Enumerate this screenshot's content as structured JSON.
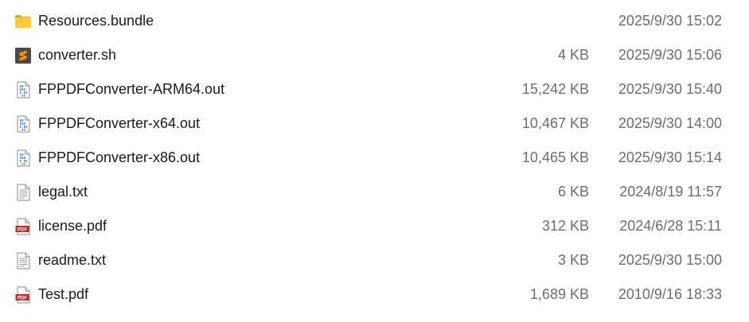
{
  "files": [
    {
      "name": "Resources.bundle",
      "size": "",
      "date": "2025/9/30 15:02",
      "icon": "folder-icon"
    },
    {
      "name": "converter.sh",
      "size": "4 KB",
      "date": "2025/9/30 15:06",
      "icon": "sublime-text-icon"
    },
    {
      "name": "FPPDFConverter-ARM64.out",
      "size": "15,242 KB",
      "date": "2025/9/30 15:40",
      "icon": "binary-file-icon"
    },
    {
      "name": "FPPDFConverter-x64.out",
      "size": "10,467 KB",
      "date": "2025/9/30 14:00",
      "icon": "binary-file-icon"
    },
    {
      "name": "FPPDFConverter-x86.out",
      "size": "10,465 KB",
      "date": "2025/9/30 15:14",
      "icon": "binary-file-icon"
    },
    {
      "name": "legal.txt",
      "size": "6 KB",
      "date": "2024/8/19 11:57",
      "icon": "text-file-icon"
    },
    {
      "name": "license.pdf",
      "size": "312 KB",
      "date": "2024/6/28 15:11",
      "icon": "pdf-file-icon"
    },
    {
      "name": "readme.txt",
      "size": "3 KB",
      "date": "2025/9/30 15:00",
      "icon": "text-file-icon"
    },
    {
      "name": "Test.pdf",
      "size": "1,689 KB",
      "date": "2010/9/16 18:33",
      "icon": "pdf-file-icon"
    }
  ],
  "colors": {
    "folder": "#ffc83d",
    "folder_tab": "#e8a317",
    "sublime_bg": "#4a4a4a",
    "sublime_accent": "#ff9800",
    "pdf_red": "#c62828",
    "binary_blue": "#5b8fd6",
    "text_gray": "#6d6d6d"
  },
  "icons": {
    "pdf_label": "PDF"
  }
}
